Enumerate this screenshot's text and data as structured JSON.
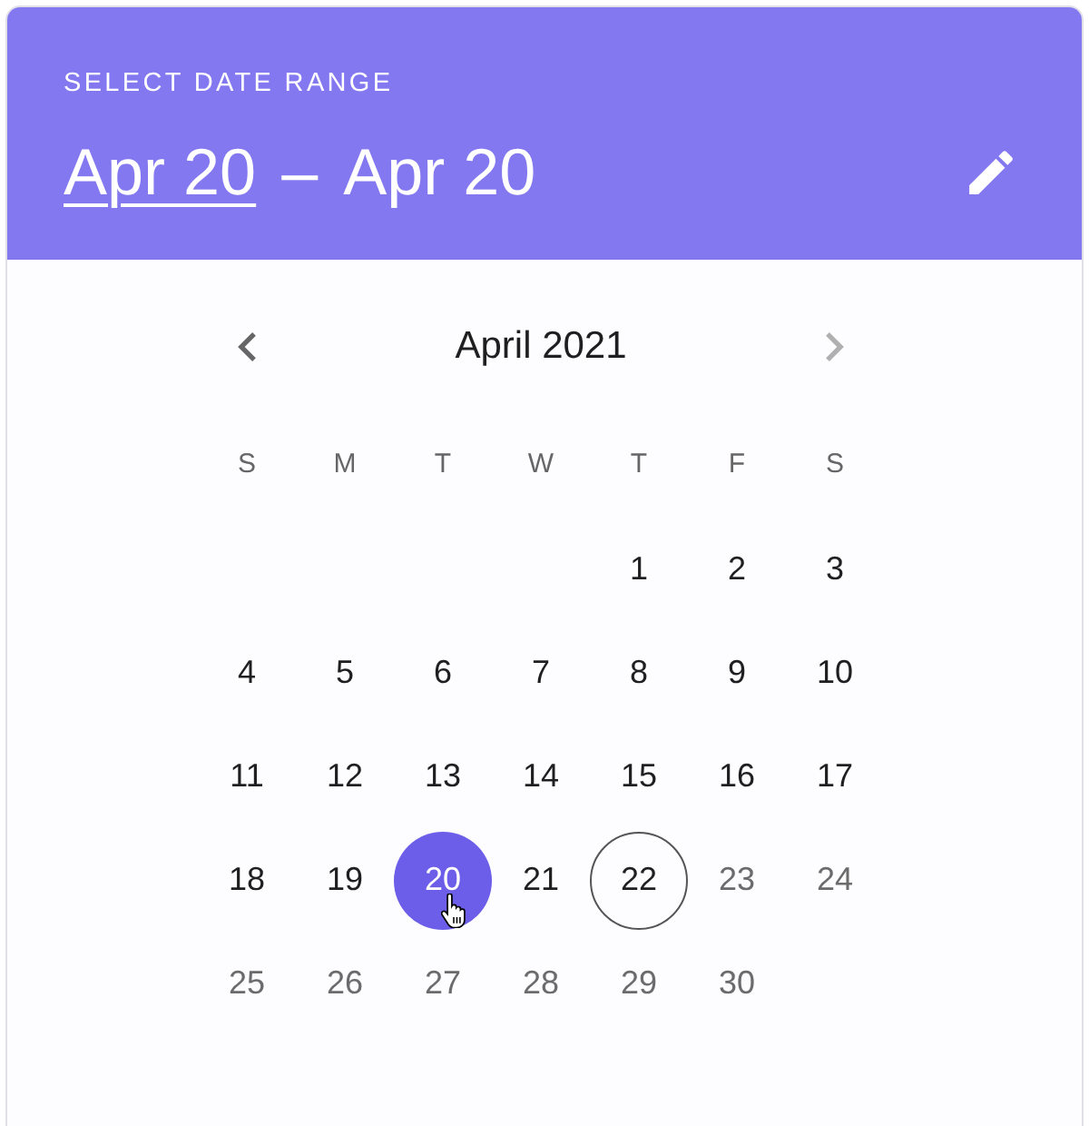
{
  "header": {
    "title": "SELECT DATE RANGE",
    "dates": [
      {
        "text": "Apr 20",
        "selected": true
      },
      {
        "text": "Apr 20",
        "selected": false
      }
    ],
    "separator": "–"
  },
  "calendar": {
    "month": "April 2021",
    "prev_button": {
      "disabled": false
    },
    "next_button": {
      "disabled": true
    },
    "weekdays": [
      "S",
      "M",
      "T",
      "W",
      "T",
      "F",
      "S"
    ],
    "weeks": [
      {
        "days": [
          {
            "label": "1",
            "selected": false,
            "today": false,
            "disabled": false
          },
          {
            "label": "2",
            "selected": false,
            "today": false,
            "disabled": false
          },
          {
            "label": "3",
            "selected": false,
            "today": false,
            "disabled": false
          }
        ]
      },
      {
        "days": [
          {
            "label": "4",
            "selected": false,
            "today": false,
            "disabled": false
          },
          {
            "label": "5",
            "selected": false,
            "today": false,
            "disabled": false
          },
          {
            "label": "6",
            "selected": false,
            "today": false,
            "disabled": false
          },
          {
            "label": "7",
            "selected": false,
            "today": false,
            "disabled": false
          },
          {
            "label": "8",
            "selected": false,
            "today": false,
            "disabled": false
          },
          {
            "label": "9",
            "selected": false,
            "today": false,
            "disabled": false
          },
          {
            "label": "10",
            "selected": false,
            "today": false,
            "disabled": false
          }
        ]
      },
      {
        "days": [
          {
            "label": "11",
            "selected": false,
            "today": false,
            "disabled": false
          },
          {
            "label": "12",
            "selected": false,
            "today": false,
            "disabled": false
          },
          {
            "label": "13",
            "selected": false,
            "today": false,
            "disabled": false
          },
          {
            "label": "14",
            "selected": false,
            "today": false,
            "disabled": false
          },
          {
            "label": "15",
            "selected": false,
            "today": false,
            "disabled": false
          },
          {
            "label": "16",
            "selected": false,
            "today": false,
            "disabled": false
          },
          {
            "label": "17",
            "selected": false,
            "today": false,
            "disabled": false
          }
        ]
      },
      {
        "days": [
          {
            "label": "18",
            "selected": false,
            "today": false,
            "disabled": false
          },
          {
            "label": "19",
            "selected": false,
            "today": false,
            "disabled": false
          },
          {
            "label": "20",
            "selected": true,
            "today": false,
            "disabled": false
          },
          {
            "label": "21",
            "selected": false,
            "today": false,
            "disabled": false
          },
          {
            "label": "22",
            "selected": false,
            "today": true,
            "disabled": false
          },
          {
            "label": "23",
            "selected": false,
            "today": false,
            "disabled": true
          },
          {
            "label": "24",
            "selected": false,
            "today": false,
            "disabled": true
          }
        ]
      },
      {
        "days": [
          {
            "label": "25",
            "selected": false,
            "today": false,
            "disabled": true
          },
          {
            "label": "26",
            "selected": false,
            "today": false,
            "disabled": true
          },
          {
            "label": "27",
            "selected": false,
            "today": false,
            "disabled": true
          },
          {
            "label": "28",
            "selected": false,
            "today": false,
            "disabled": true
          },
          {
            "label": "29",
            "selected": false,
            "today": false,
            "disabled": true
          },
          {
            "label": "30",
            "selected": false,
            "today": false,
            "disabled": true
          }
        ]
      }
    ]
  }
}
